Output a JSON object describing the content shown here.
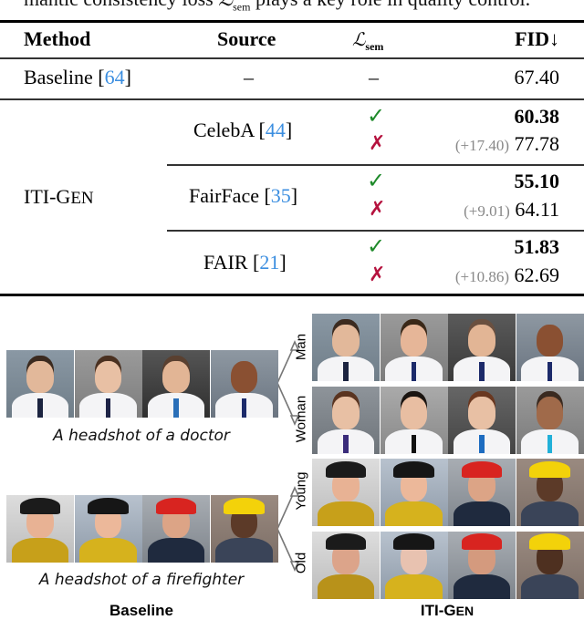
{
  "caption_fragment": {
    "before": "mantic consistency loss ",
    "symbol": "ℒ",
    "subscript": "sem",
    "after": " plays a key role in quality control."
  },
  "table": {
    "headers": {
      "method": "Method",
      "source": "Source",
      "loss": "ℒ",
      "loss_sub": "sem",
      "fid": "FID↓"
    },
    "baseline": {
      "method": "Baseline ",
      "cite": "64",
      "source": "–",
      "loss": "–",
      "fid": "67.40"
    },
    "iti_gen": {
      "method_prefix": "ITI-G",
      "method_suffix": "EN",
      "groups": [
        {
          "source": "CelebA ",
          "cite": "44",
          "with_loss": {
            "mark": "✓",
            "fid": "60.38"
          },
          "without_loss": {
            "mark": "✗",
            "delta": "(+17.40)",
            "fid": "77.78"
          }
        },
        {
          "source": "FairFace ",
          "cite": "35",
          "with_loss": {
            "mark": "✓",
            "fid": "55.10"
          },
          "without_loss": {
            "mark": "✗",
            "delta": "(+9.01)",
            "fid": "64.11"
          }
        },
        {
          "source": "FAIR ",
          "cite": "21",
          "with_loss": {
            "mark": "✓",
            "fid": "51.83"
          },
          "without_loss": {
            "mark": "✗",
            "delta": "(+10.86)",
            "fid": "62.69"
          }
        }
      ]
    }
  },
  "figure": {
    "left": {
      "prompts": [
        "A headshot of a doctor",
        "A headshot of a firefighter"
      ],
      "label": "Baseline"
    },
    "right": {
      "row_labels": [
        "Man",
        "Woman",
        "Young",
        "Old"
      ],
      "label_prefix": "ITI-G",
      "label_suffix": "EN"
    },
    "photo_descriptions": {
      "doctor": "generated doctor headshot",
      "firefighter": "generated firefighter headshot"
    }
  },
  "colors": {
    "citation": "#3b8ee0",
    "check": "#1e8a2a",
    "cross": "#b5123e",
    "delta": "#888888"
  }
}
